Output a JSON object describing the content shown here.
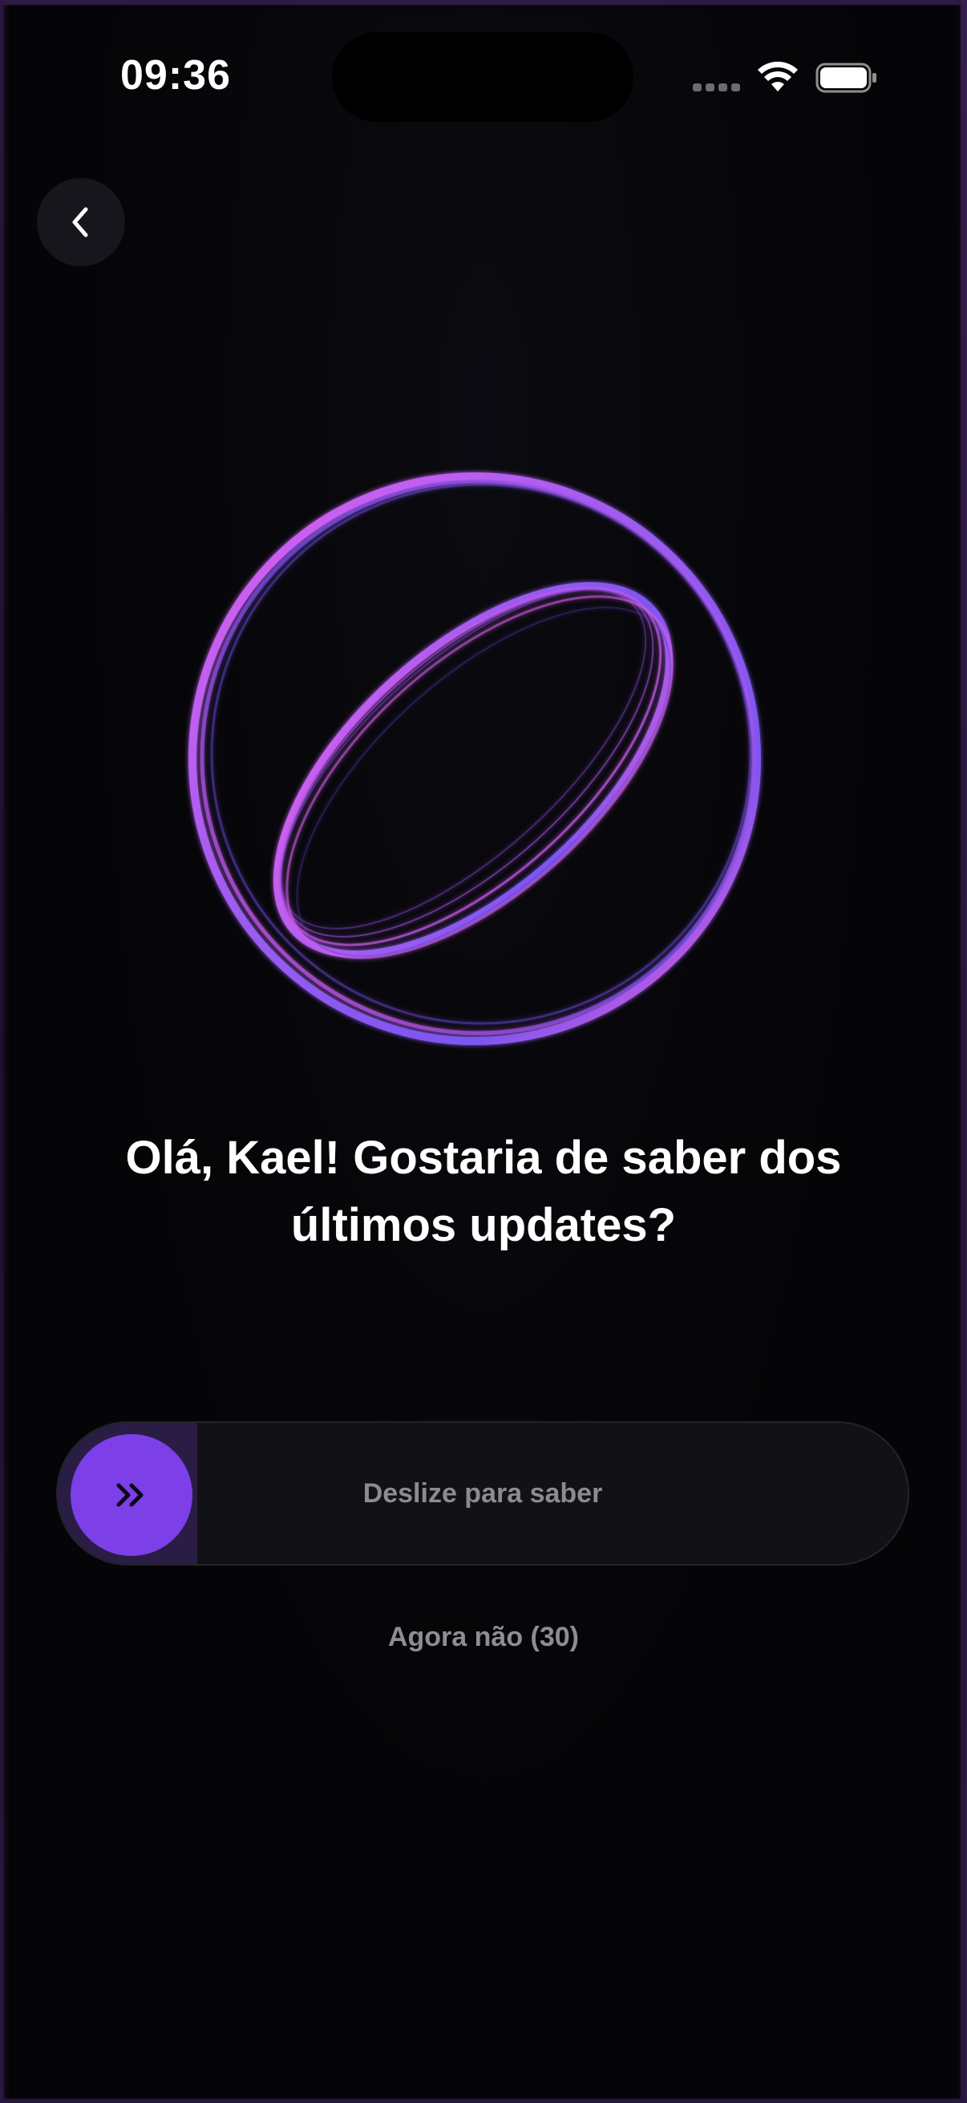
{
  "status_bar": {
    "time": "09:36",
    "icons": [
      "cellular-signal-icon",
      "wifi-icon",
      "battery-icon"
    ]
  },
  "nav": {
    "back_icon": "chevron-left-icon"
  },
  "hero": {
    "orb_icon": "orb-rings-icon",
    "colors": {
      "pink": "#e060f0",
      "violet": "#9a5cf0",
      "deep": "#5b3bd0"
    }
  },
  "greeting": {
    "line1": "Olá, Kael! Gostaria de saber dos",
    "line2": "últimos updates?"
  },
  "swipe": {
    "label": "Deslize para saber",
    "thumb_icon": "double-chevron-right-icon",
    "accent": "#7c3fe8",
    "progress": 0
  },
  "later": {
    "label": "Agora não (30)"
  }
}
